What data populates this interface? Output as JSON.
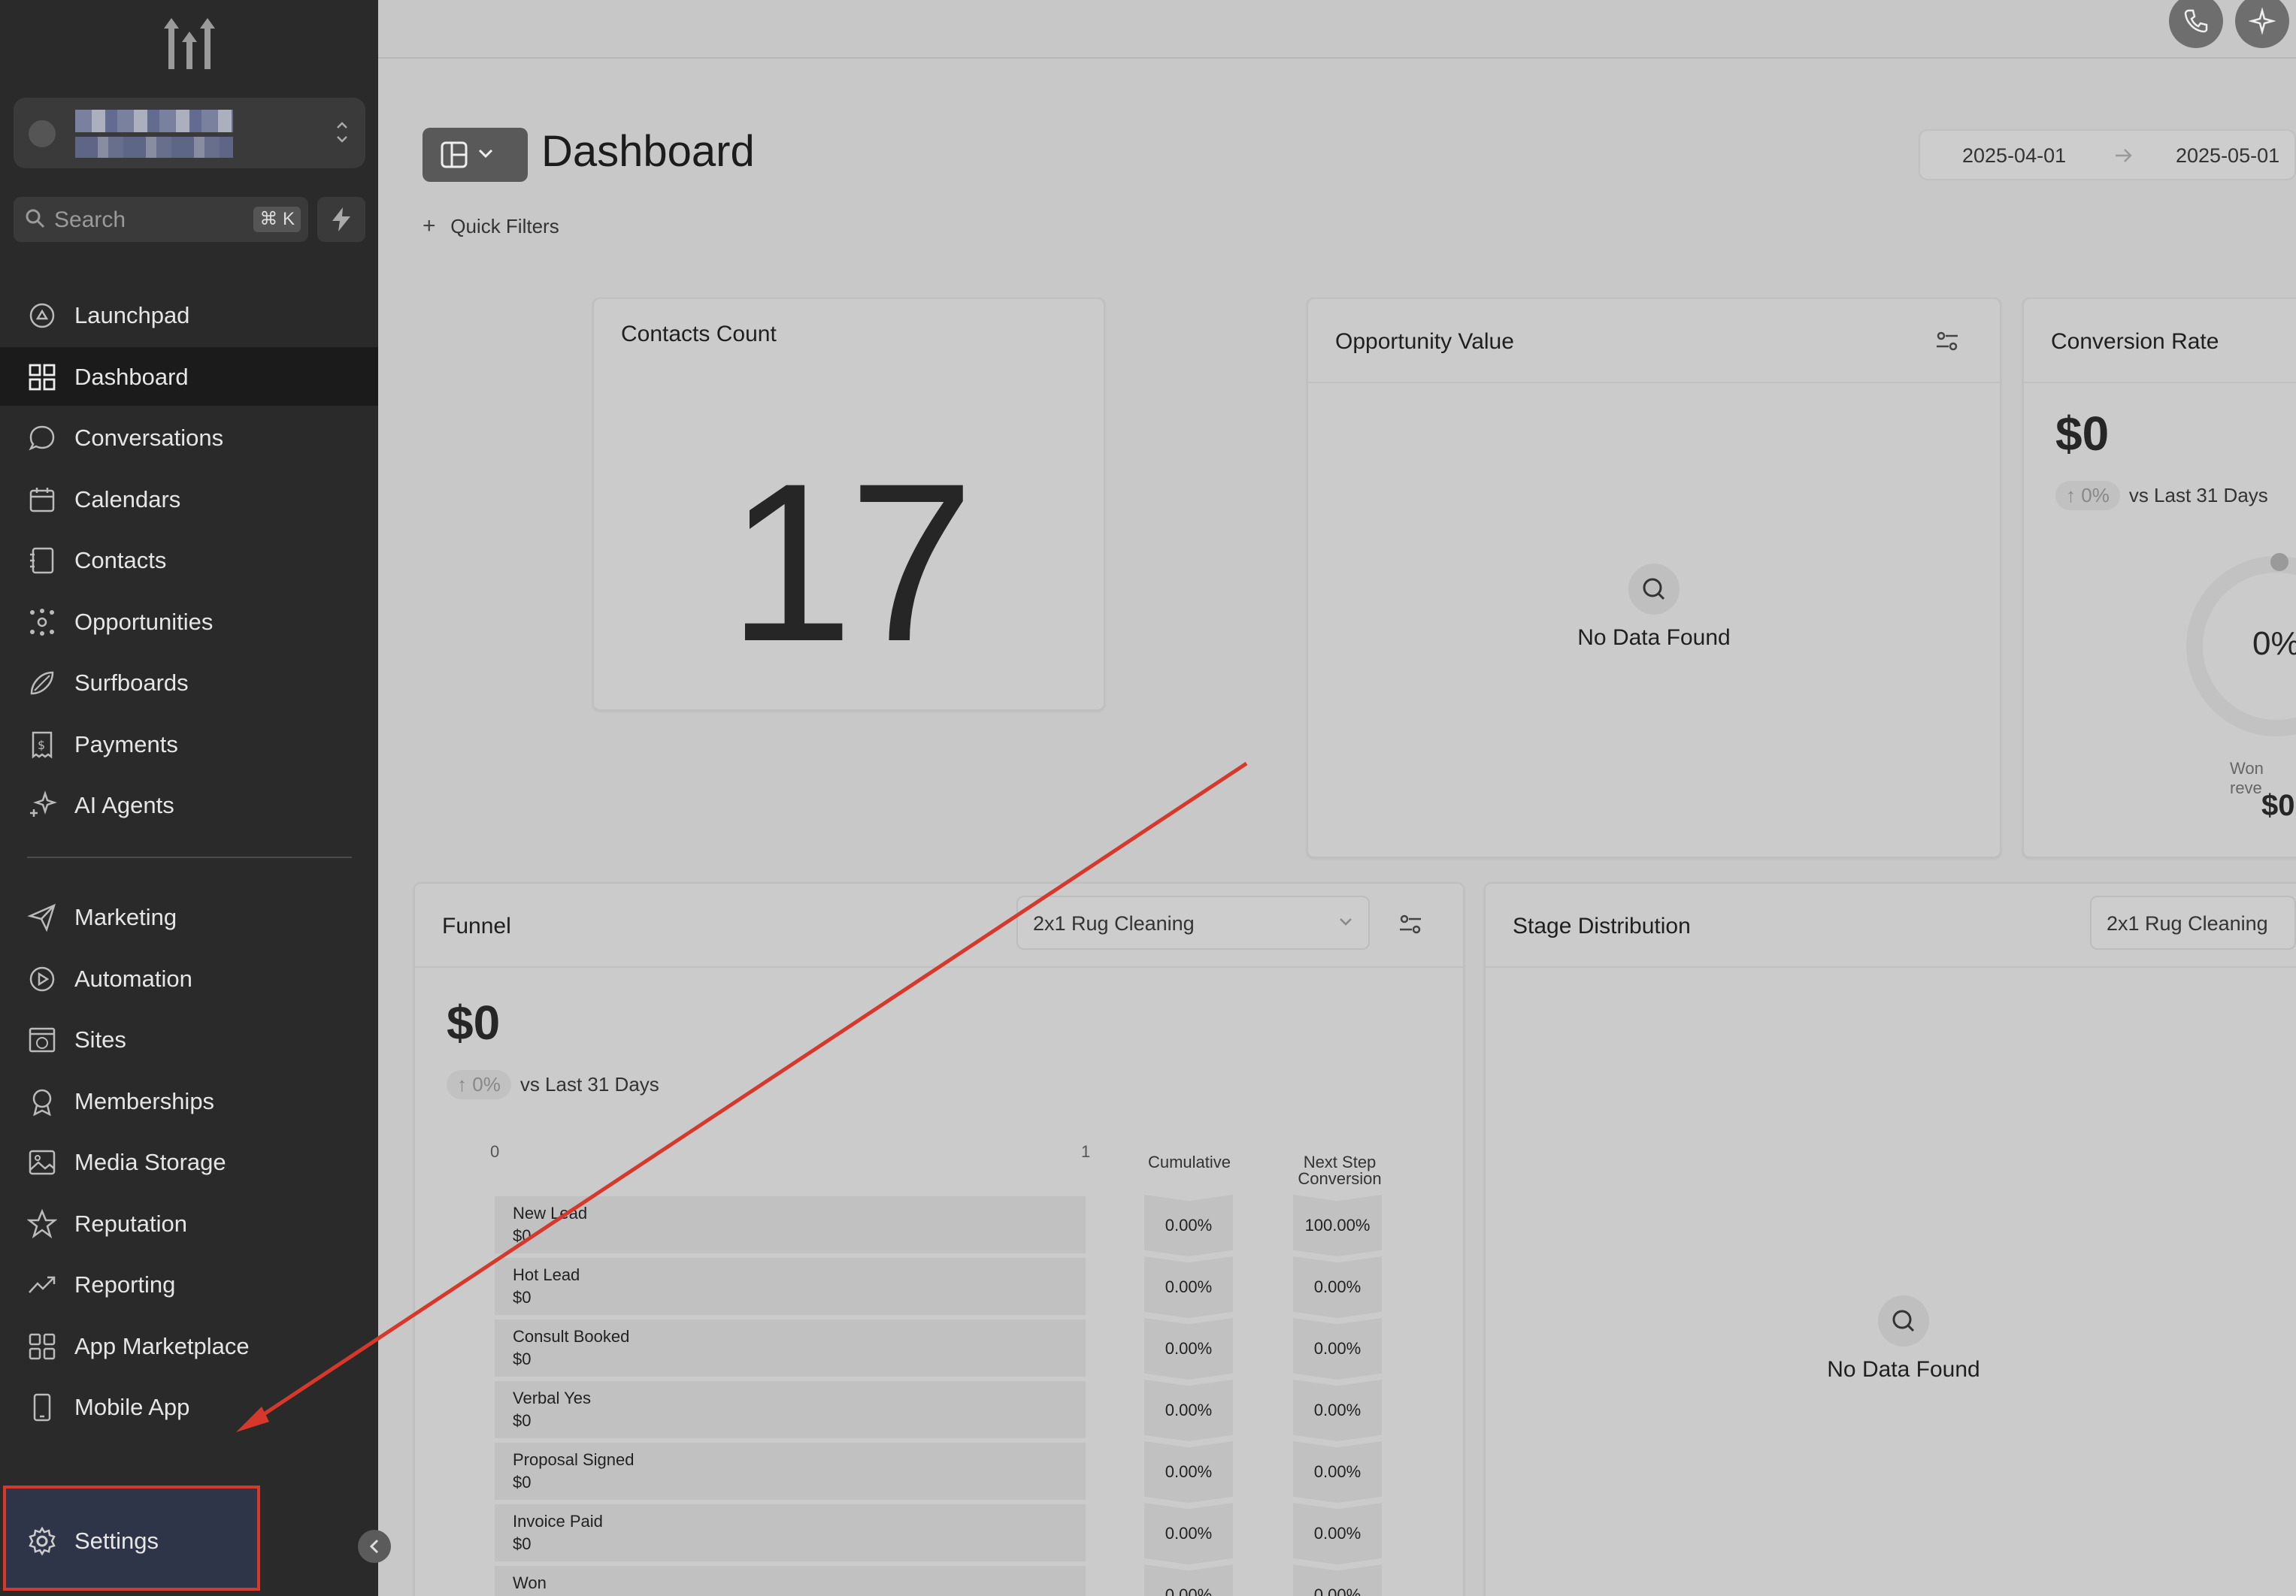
{
  "sidebar": {
    "search_placeholder": "Search",
    "search_shortcut": "⌘ K",
    "nav_top": [
      {
        "label": "Launchpad",
        "icon": "launchpad-icon"
      },
      {
        "label": "Dashboard",
        "icon": "dashboard-icon",
        "active": true
      },
      {
        "label": "Conversations",
        "icon": "chat-bubble-icon"
      },
      {
        "label": "Calendars",
        "icon": "calendar-icon"
      },
      {
        "label": "Contacts",
        "icon": "contacts-book-icon"
      },
      {
        "label": "Opportunities",
        "icon": "opportunities-icon"
      },
      {
        "label": "Surfboards",
        "icon": "surfboard-icon"
      },
      {
        "label": "Payments",
        "icon": "receipt-dollar-icon"
      },
      {
        "label": "AI Agents",
        "icon": "sparkle-icon"
      }
    ],
    "nav_bottom": [
      {
        "label": "Marketing",
        "icon": "paper-plane-icon"
      },
      {
        "label": "Automation",
        "icon": "automation-play-icon"
      },
      {
        "label": "Sites",
        "icon": "globe-window-icon"
      },
      {
        "label": "Memberships",
        "icon": "badge-icon"
      },
      {
        "label": "Media Storage",
        "icon": "image-icon"
      },
      {
        "label": "Reputation",
        "icon": "star-icon"
      },
      {
        "label": "Reporting",
        "icon": "trend-up-icon"
      },
      {
        "label": "App Marketplace",
        "icon": "grid-apps-icon"
      },
      {
        "label": "Mobile App",
        "icon": "mobile-phone-icon"
      }
    ],
    "settings_label": "Settings"
  },
  "header": {
    "title": "Dashboard",
    "date_start": "2025-04-01",
    "date_end": "2025-05-01",
    "quick_filters": "Quick Filters"
  },
  "contacts_card": {
    "title": "Contacts Count",
    "value": "17"
  },
  "opportunity_card": {
    "title": "Opportunity Value",
    "empty_text": "No Data Found"
  },
  "conversion_card": {
    "title": "Conversion Rate",
    "value": "$0",
    "delta_pct": "0%",
    "delta_label": "vs Last 31 Days",
    "gauge_pct": "0%",
    "won_label": "Won reve",
    "won_value": "$0"
  },
  "funnel_card": {
    "title": "Funnel",
    "pipeline": "2x1 Rug Cleaning",
    "value": "$0",
    "delta_pct": "0%",
    "delta_label": "vs Last 31 Days",
    "axis_min": "0",
    "axis_max": "1",
    "col_cumulative": "Cumulative",
    "col_next_step_1": "Next Step",
    "col_next_step_2": "Conversion",
    "stages": [
      {
        "name": "New Lead",
        "value": "$0",
        "cumulative": "0.00%",
        "next": "100.00%"
      },
      {
        "name": "Hot Lead",
        "value": "$0",
        "cumulative": "0.00%",
        "next": "0.00%"
      },
      {
        "name": "Consult Booked",
        "value": "$0",
        "cumulative": "0.00%",
        "next": "0.00%"
      },
      {
        "name": "Verbal Yes",
        "value": "$0",
        "cumulative": "0.00%",
        "next": "0.00%"
      },
      {
        "name": "Proposal Signed",
        "value": "$0",
        "cumulative": "0.00%",
        "next": "0.00%"
      },
      {
        "name": "Invoice Paid",
        "value": "$0",
        "cumulative": "0.00%",
        "next": "0.00%"
      },
      {
        "name": "Won",
        "value": "",
        "cumulative": "0.00%",
        "next": "0.00%"
      }
    ]
  },
  "stage_card": {
    "title": "Stage Distribution",
    "pipeline": "2x1 Rug Cleaning",
    "empty_text": "No Data Found"
  },
  "colors": {
    "sidebar_bg": "#2a2a2a",
    "annotation_red": "#d6392c"
  }
}
